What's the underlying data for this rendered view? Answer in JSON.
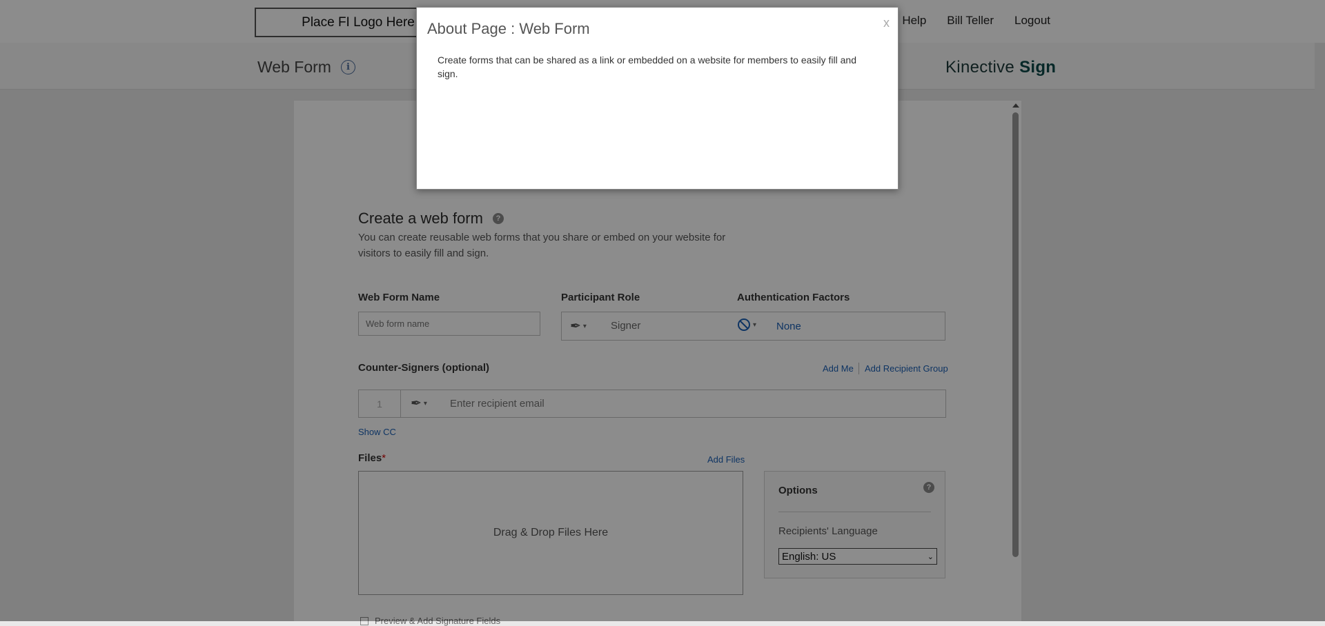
{
  "topbar": {
    "logo_text": "Place FI Logo Here",
    "links": {
      "help": "Help",
      "user": "Bill Teller",
      "logout": "Logout"
    }
  },
  "subheader": {
    "title": "Web Form",
    "brand_main": "Kinective ",
    "brand_bold": "Sign"
  },
  "form": {
    "heading": "Create a web form",
    "description": "You can create reusable web forms that you share or embed on your website for visitors to easily fill and sign.",
    "name_label": "Web Form Name",
    "name_placeholder": "Web form name",
    "role_label": "Participant Role",
    "role_value": "Signer",
    "auth_label": "Authentication Factors",
    "auth_value": "None",
    "counter_label": "Counter-Signers (optional)",
    "add_me": "Add Me",
    "add_group": "Add Recipient Group",
    "recipient_index": "1",
    "recipient_placeholder": "Enter recipient email",
    "show_cc": "Show CC",
    "files_label": "Files",
    "files_required": "*",
    "add_files": "Add Files",
    "drop_text": "Drag & Drop Files Here",
    "options_title": "Options",
    "recipients_language_label": "Recipients' Language",
    "language_value": "English: US",
    "bottom_text": "Preview & Add Signature Fields"
  },
  "modal": {
    "title": "About Page : Web Form",
    "close": "x",
    "body": "Create forms that can be shared as a link or embedded on a website for members to easily fill and sign."
  },
  "colors": {
    "link": "#1a5fb4",
    "overlay": "rgba(0,0,0,0.45)",
    "brand": "#0d4a4a"
  }
}
